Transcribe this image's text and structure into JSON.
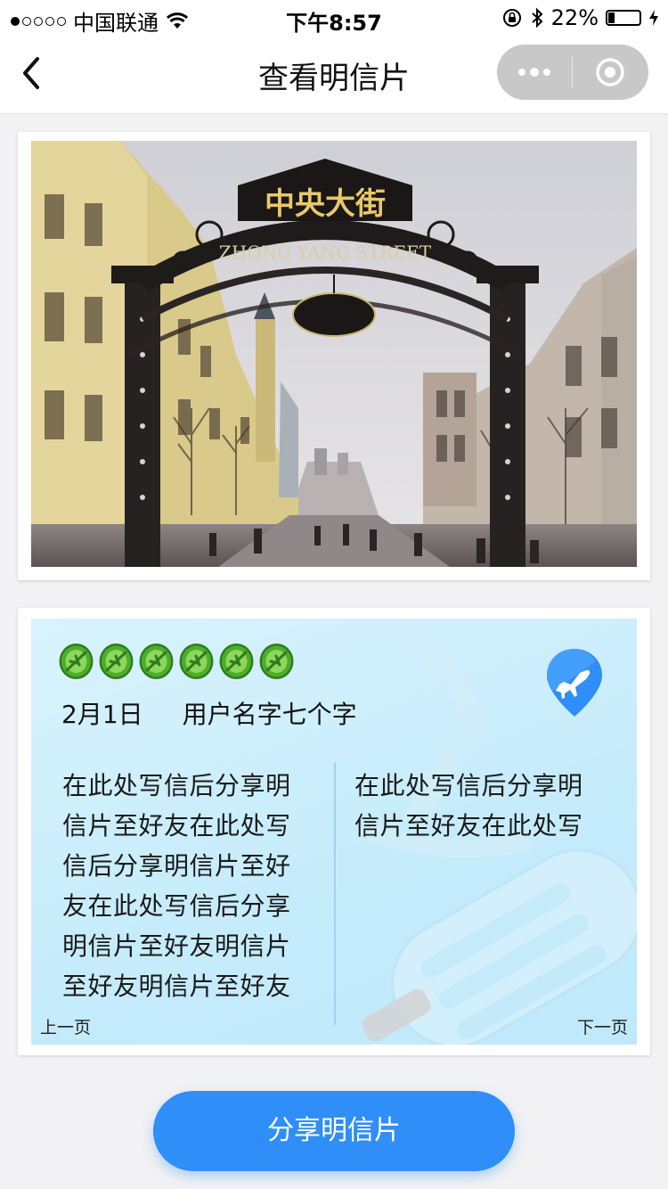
{
  "status_bar": {
    "carrier": "中国联通",
    "time": "下午8:57",
    "battery": "22%",
    "battery_level": 0.22
  },
  "nav": {
    "title": "查看明信片"
  },
  "postcard": {
    "photo_sign_text": "中央大街",
    "photo_sign_subtext": "ZHONG YANG STREET",
    "date": "2月1日",
    "user_name": "用户名字七个字",
    "message_left": [
      "在此处写信后分享明",
      "信片至好友在此处写",
      "信后分享明信片至好",
      "友在此处写信后分享",
      "明信片至好友明信片",
      "至好友明信片至好友"
    ],
    "message_right": [
      "在此处写信后分享明",
      "信片至好友在此处写"
    ],
    "prev_label": "上一页",
    "next_label": "下一页",
    "stamp_count": 6
  },
  "share_button": "分享明信片",
  "colors": {
    "accent": "#2f8ef7",
    "card_bg": "#c6ecfb",
    "stamp_green": "#4caf2b"
  }
}
